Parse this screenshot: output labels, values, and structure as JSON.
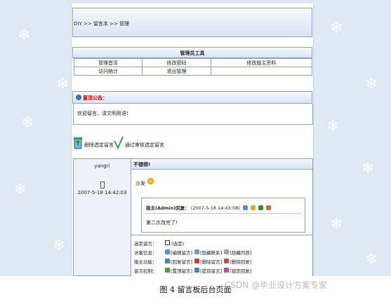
{
  "breadcrumb": {
    "text": "DIY >> 留言本 >> 管理"
  },
  "admin_tools": {
    "title": "管理员工具",
    "row1": [
      "管理首页",
      "修改密码",
      "修改版主资料"
    ],
    "row2": [
      "访问统计",
      "退出管理"
    ]
  },
  "notice": {
    "title": "置顶公告：",
    "body": "欢迎留言，请文明用语!"
  },
  "actions": {
    "delete_selected": "删除选定留言",
    "approve_selected": "通过审核选定留言"
  },
  "post": {
    "author": "yangri",
    "time": "2007-5-18 14:42:03",
    "title": "不错得!",
    "content": "沙发",
    "reply": {
      "label": "版主(Admin)回复：",
      "time": "(2007-5-18 14:43:08)",
      "text": "第二次改完了!"
    },
    "controls": [
      {
        "label": "选定留言：",
        "items": [
          "(选定)"
        ]
      },
      {
        "label": "访客信息：",
        "items": [
          "[编辑留言]",
          "[隐藏联系]",
          "[隐藏内容]"
        ]
      },
      {
        "label": "版主功能：",
        "items": [
          "[回复留言]",
          "[删除留言]",
          "[删除回复]"
        ]
      },
      {
        "label": "留言控制：",
        "items": [
          "[置顶留言]",
          "[提前留言]",
          "[锁定回复]"
        ]
      }
    ]
  },
  "caption": "图 4  留言板后台页面",
  "watermark": "CSDN @毕业设计方案专家",
  "colors": {
    "background": "#dfe9f4",
    "border": "#8aa4c4",
    "notice_title": "#cc0000"
  }
}
